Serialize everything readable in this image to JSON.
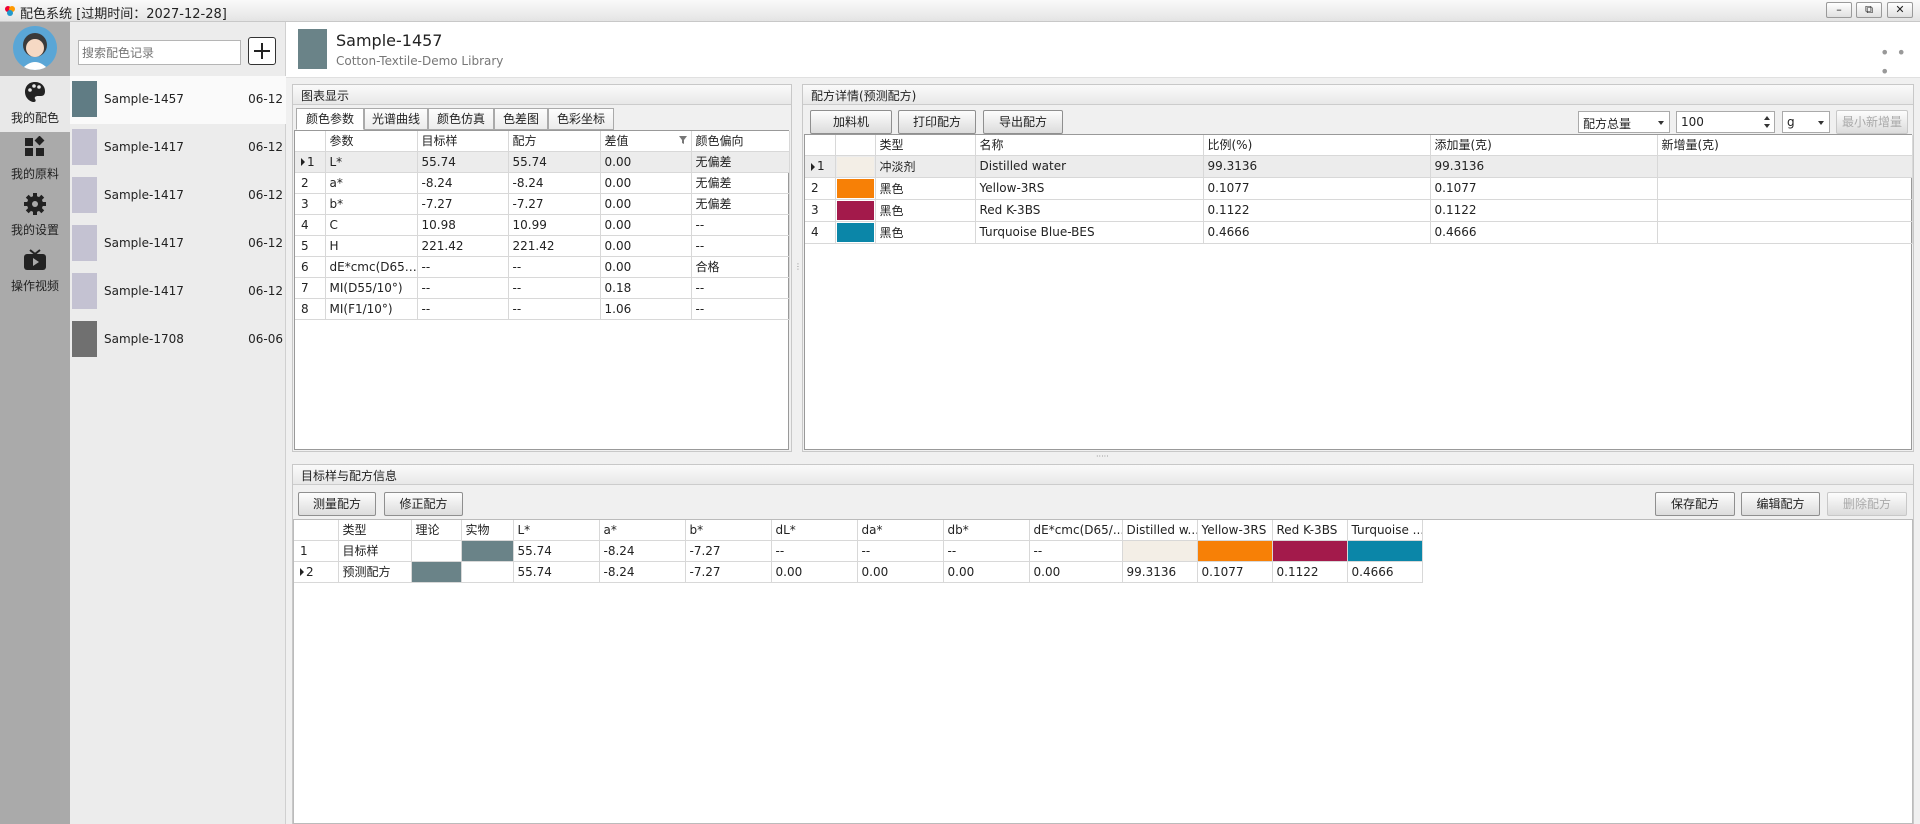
{
  "window": {
    "title": "配色系统 [过期时间：2027-12-28]",
    "min": "–",
    "max": "⧉",
    "close": "✕"
  },
  "nav": [
    {
      "label": "我的配色",
      "icon": "palette-icon"
    },
    {
      "label": "我的原料",
      "icon": "grid-icon"
    },
    {
      "label": "我的设置",
      "icon": "gear-icon"
    },
    {
      "label": "操作视频",
      "icon": "video-icon"
    }
  ],
  "search": {
    "placeholder": "搜索配色记录"
  },
  "records": [
    {
      "name": "Sample-1457",
      "date": "06-12",
      "color": "#607c84"
    },
    {
      "name": "Sample-1417",
      "date": "06-12",
      "color": "#c4c2d2"
    },
    {
      "name": "Sample-1417",
      "date": "06-12",
      "color": "#c4c2d2"
    },
    {
      "name": "Sample-1417",
      "date": "06-12",
      "color": "#c4c2d2"
    },
    {
      "name": "Sample-1417",
      "date": "06-12",
      "color": "#c4c2d2"
    },
    {
      "name": "Sample-1708",
      "date": "06-06",
      "color": "#707070"
    }
  ],
  "header": {
    "title": "Sample-1457",
    "subtitle": "Cotton-Textile-Demo Library",
    "color": "#6a8388",
    "more": "• • •"
  },
  "chart_panel": {
    "title": "图表显示",
    "tabs": [
      "颜色参数",
      "光谱曲线",
      "颜色仿真",
      "色差图",
      "色彩坐标"
    ],
    "columns": [
      "参数",
      "目标样",
      "配方",
      "差值",
      "颜色偏向"
    ],
    "rows": [
      [
        "1",
        "L*",
        "55.74",
        "55.74",
        "0.00",
        "无偏差"
      ],
      [
        "2",
        "a*",
        "-8.24",
        "-8.24",
        "0.00",
        "无偏差"
      ],
      [
        "3",
        "b*",
        "-7.27",
        "-7.27",
        "0.00",
        "无偏差"
      ],
      [
        "4",
        "C",
        "10.98",
        "10.99",
        "0.00",
        "--"
      ],
      [
        "5",
        "H",
        "221.42",
        "221.42",
        "0.00",
        "--"
      ],
      [
        "6",
        "dE*cmc(D65…",
        "--",
        "--",
        "0.00",
        "合格"
      ],
      [
        "7",
        "MI(D55/10°)",
        "--",
        "--",
        "0.18",
        "--"
      ],
      [
        "8",
        "MI(F1/10°)",
        "--",
        "--",
        "1.06",
        "--"
      ]
    ]
  },
  "recipe_panel": {
    "title": "配方详情(预测配方)",
    "buttons": [
      "加料机",
      "打印配方",
      "导出配方"
    ],
    "total_select": "配方总量",
    "total_value": "100",
    "unit": "g",
    "min_increase": "最小新增量",
    "columns": [
      "类型",
      "名称",
      "比例(%)",
      "添加量(克)",
      "新增量(克)"
    ],
    "rows": [
      {
        "n": "1",
        "color": "#f3eee6",
        "type": "冲淡剂",
        "name": "Distilled water",
        "ratio": "99.3136",
        "amount": "99.3136",
        "inc": ""
      },
      {
        "n": "2",
        "color": "#f78006",
        "type": "黑色",
        "name": "Yellow-3RS",
        "ratio": "0.1077",
        "amount": "0.1077",
        "inc": ""
      },
      {
        "n": "3",
        "color": "#a31a4b",
        "type": "黑色",
        "name": "Red K-3BS",
        "ratio": "0.1122",
        "amount": "0.1122",
        "inc": ""
      },
      {
        "n": "4",
        "color": "#0b86a8",
        "type": "黑色",
        "name": "Turquoise Blue-BES",
        "ratio": "0.4666",
        "amount": "0.4666",
        "inc": ""
      }
    ]
  },
  "info_panel": {
    "title": "目标样与配方信息",
    "left_buttons": [
      "测量配方",
      "修正配方"
    ],
    "right_buttons": [
      "保存配方",
      "编辑配方",
      "删除配方"
    ],
    "columns": [
      "类型",
      "理论",
      "实物",
      "L*",
      "a*",
      "b*",
      "dL*",
      "da*",
      "db*",
      "dE*cmc(D65/...",
      "Distilled w...",
      "Yellow-3RS",
      "Red K-3BS",
      "Turquoise ..."
    ],
    "rows": [
      {
        "n": "1",
        "type": "目标样",
        "theory": "",
        "theory_color": "",
        "real_color": "#6a8388",
        "L": "55.74",
        "a": "-8.24",
        "b": "-7.27",
        "dL": "--",
        "da": "--",
        "db": "--",
        "dE": "--",
        "c1": "",
        "c2": "",
        "c3": "",
        "c4": ""
      },
      {
        "n": "2",
        "type": "预测配方",
        "theory": "",
        "theory_color": "#6a8388",
        "real_color": "",
        "L": "55.74",
        "a": "-8.24",
        "b": "-7.27",
        "dL": "0.00",
        "da": "0.00",
        "db": "0.00",
        "dE": "0.00",
        "c1": "99.3136",
        "c2": "0.1077",
        "c3": "0.1122",
        "c4": "0.4666"
      }
    ],
    "swatch_colors": [
      "#f3eee6",
      "#f78006",
      "#a31a4b",
      "#0b86a8"
    ]
  }
}
